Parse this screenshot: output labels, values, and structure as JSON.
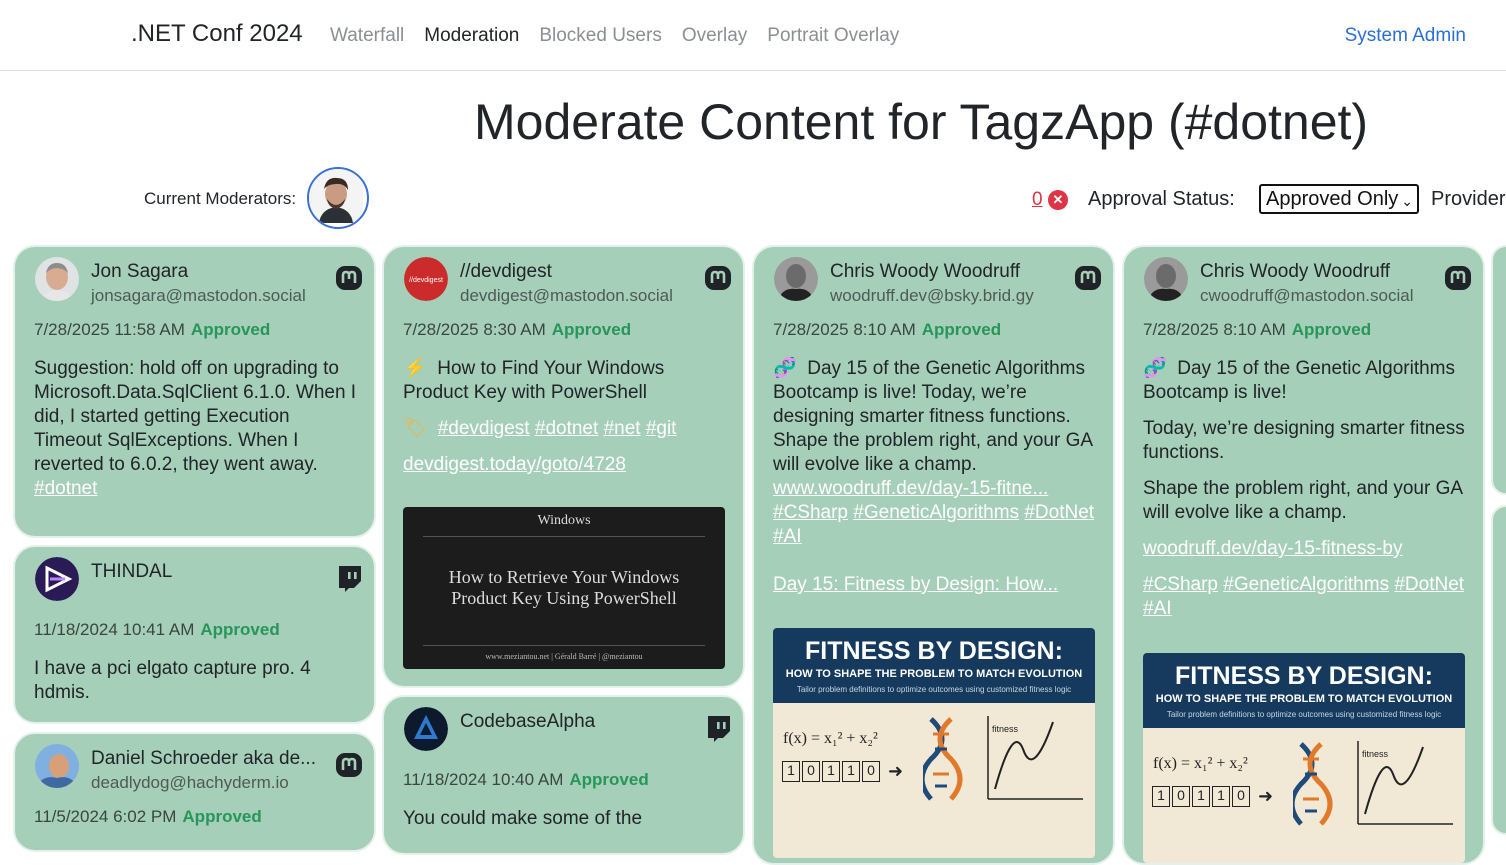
{
  "nav": {
    "brand": ".NET Conf 2024",
    "links": [
      "Waterfall",
      "Moderation",
      "Blocked Users",
      "Overlay",
      "Portrait Overlay"
    ],
    "active": "Moderation",
    "user": "System Admin"
  },
  "header": {
    "title": "Moderate Content for TagzApp (#dotnet)",
    "moderators_label": "Current Moderators:",
    "pending_count": "0",
    "approval_label": "Approval Status:",
    "approval_value": "Approved Only",
    "providers_label": "Providers"
  },
  "cards": [
    {
      "name": "Jon Sagara",
      "handle": "jonsagara@mastodon.social",
      "provider": "mastodon-icon",
      "date": "7/28/2025 11:58 AM",
      "status": "Approved",
      "text": "Suggestion: hold off on upgrading to Microsoft.Data.SqlClient 6.1.0. When I did, I started getting Execution Timeout SqlExceptions. When I reverted to 6.0.2, they went away.",
      "tag": "#dotnet"
    },
    {
      "name": "THINDAL",
      "handle": "",
      "provider": "twitch-icon",
      "date": "11/18/2024 10:41 AM",
      "status": "Approved",
      "text": "I have a pci elgato capture pro. 4 hdmis."
    },
    {
      "name": "Daniel Schroeder aka de...",
      "handle": "deadlydog@hachyderm.io",
      "provider": "mastodon-icon",
      "date": "11/5/2024 6:02 PM",
      "status": "Approved"
    },
    {
      "name": "//devdigest",
      "handle": "devdigest@mastodon.social",
      "provider": "mastodon-icon",
      "date": "7/28/2025 8:30 AM",
      "status": "Approved",
      "text": "How to Find Your Windows Product Key with PowerShell",
      "tags": [
        "#devdigest",
        "#dotnet",
        "#net",
        "#git"
      ],
      "link": "devdigest.today/goto/4728",
      "thumb": {
        "top": "Windows",
        "title": "How to Retrieve Your Windows Product Key Using PowerShell",
        "footer": "www.meziantou.net | Gérald Barré | @meziantou"
      }
    },
    {
      "name": "CodebaseAlpha",
      "handle": "",
      "provider": "twitch-icon",
      "date": "11/18/2024 10:40 AM",
      "status": "Approved",
      "text": "You could make some of the"
    },
    {
      "name": "Chris Woody Woodruff",
      "handle": "woodruff.dev@bsky.brid.gy",
      "provider": "mastodon-icon",
      "date": "7/28/2025 8:10 AM",
      "status": "Approved",
      "text": "Day 15 of the Genetic Algorithms Bootcamp is live! Today, we’re designing smarter fitness functions. Shape the problem right, and your GA will evolve like a champ.",
      "link": "www.woodruff.dev/day-15-fitne...",
      "tags": [
        "#CSharp",
        "#GeneticAlgorithms",
        "#DotNet",
        "#AI"
      ],
      "link2": "Day 15: Fitness by Design: How..."
    },
    {
      "name": "Chris Woody Woodruff",
      "handle": "cwoodruff@mastodon.social",
      "provider": "mastodon-icon",
      "date": "7/28/2025 8:10 AM",
      "status": "Approved",
      "p1": "Day 15 of the Genetic Algorithms Bootcamp is live!",
      "p2": "Today, we’re designing smarter fitness functions.",
      "p3": "Shape the problem right, and your GA will evolve like a champ.",
      "link": "woodruff.dev/day-15-fitness-by",
      "tags": [
        "#CSharp",
        "#GeneticAlgorithms",
        "#DotNet",
        "#AI"
      ]
    }
  ],
  "fitness_image": {
    "title": "FITNESS BY DESIGN:",
    "subtitle": "HOW TO SHAPE THE PROBLEM TO MATCH EVOLUTION",
    "caption": "Tailor problem definitions to optimize outcomes using customized fitness logic",
    "formula": "f(x) = x₁² + x₂²",
    "bits": [
      "1",
      "0",
      "1",
      "1",
      "0"
    ],
    "axis_label": "fitness"
  },
  "colors": {
    "card_bg": "#a6cfb9",
    "approved": "#27965a",
    "link_blue": "#2a6fd6",
    "danger": "#dc3545"
  }
}
